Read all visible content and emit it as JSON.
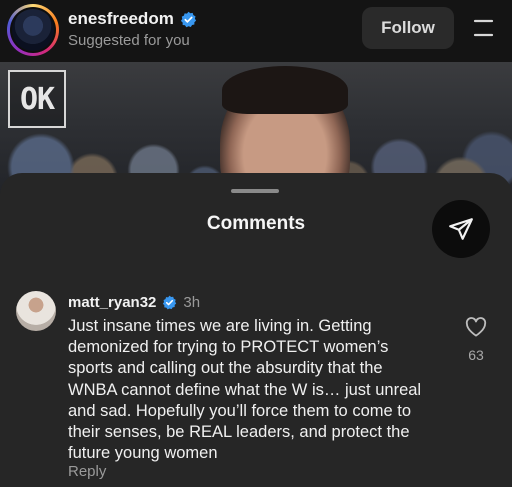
{
  "header": {
    "username": "enesfreedom",
    "subtitle": "Suggested for you",
    "follow_label": "Follow"
  },
  "video": {
    "logo_text": "OK"
  },
  "comments_sheet": {
    "title": "Comments",
    "comment": {
      "username": "matt_ryan32",
      "time": "3h",
      "text": "Just insane times we are living in. Getting demonized for trying to PROTECT women’s sports and calling out the absurdity that the WNBA cannot define what the W is… just unreal and sad. Hopefully you’ll force them to come to their senses, be REAL leaders, and protect the future young women",
      "likes": "63",
      "reply_label": "Reply"
    }
  },
  "icons": {
    "verified": "verified-badge-icon",
    "menu": "hamburger-menu-icon",
    "share": "send-paper-plane-icon",
    "like": "heart-icon"
  },
  "colors": {
    "verified_blue": "#3897f0",
    "sheet_bg": "#262626",
    "topbar_bg": "#141414"
  }
}
